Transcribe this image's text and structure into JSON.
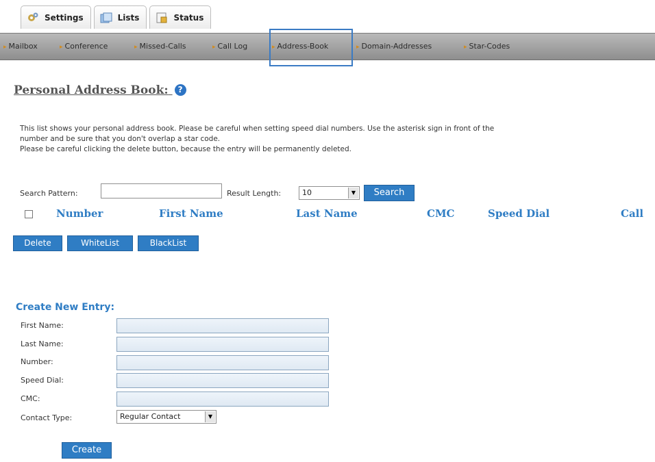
{
  "tabs": [
    {
      "label": "Settings",
      "icon": "settings-icon"
    },
    {
      "label": "Lists",
      "icon": "lists-icon"
    },
    {
      "label": "Status",
      "icon": "status-icon"
    }
  ],
  "subnav": {
    "items": [
      "Mailbox",
      "Conference",
      "Missed-Calls",
      "Call Log",
      "Address-Book",
      "Domain-Addresses",
      "Star-Codes"
    ],
    "selected": "Address-Book"
  },
  "page": {
    "title": "Personal Address Book:",
    "help_icon": "?",
    "description": [
      "This list shows your personal address book. Please be careful when setting speed dial numbers. Use the asterisk sign in front of the",
      "number and be sure that you don't overlap a star code.",
      "Please be careful clicking the delete button, because the entry will be permanently deleted."
    ]
  },
  "search": {
    "pattern_label": "Search Pattern:",
    "pattern_value": "",
    "result_length_label": "Result Length:",
    "result_length_value": "10",
    "button": "Search"
  },
  "table": {
    "columns": [
      "Number",
      "First Name",
      "Last Name",
      "CMC",
      "Speed Dial",
      "Call"
    ]
  },
  "actions": {
    "delete": "Delete",
    "whitelist": "WhiteList",
    "blacklist": "BlackList"
  },
  "create": {
    "title": "Create New Entry:",
    "fields": [
      {
        "label": "First Name:",
        "value": ""
      },
      {
        "label": "Last Name:",
        "value": ""
      },
      {
        "label": "Number:",
        "value": ""
      },
      {
        "label": "Speed Dial:",
        "value": ""
      },
      {
        "label": "CMC:",
        "value": ""
      }
    ],
    "contact_type_label": "Contact Type:",
    "contact_type_value": "Regular Contact",
    "button": "Create"
  },
  "colors": {
    "accent": "#2f7dc4",
    "nav_gradient_top": "#b9b9b9",
    "nav_gradient_bottom": "#8e8e8e",
    "nav_arrow": "#d28b1e"
  }
}
